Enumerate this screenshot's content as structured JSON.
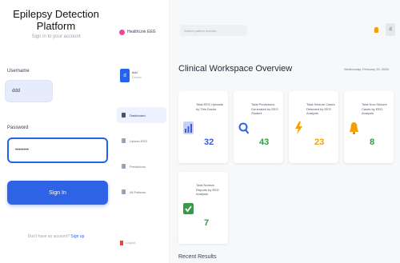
{
  "login": {
    "title": "Epilepsy Detection Platform",
    "subtitle": "Sign in to your account",
    "username_label": "Username",
    "username_value": "ddd",
    "password_label": "Password",
    "password_value": "••••••••",
    "signin_label": "Sign In",
    "signup_text": "Don't have an account?",
    "signup_link": "Sign up"
  },
  "sidebar": {
    "brand": "HealthLink EEG",
    "user_initial": "d",
    "user_name": "ddd",
    "user_role": "Doctor",
    "items": [
      {
        "label": "Dashboard",
        "active": true
      },
      {
        "label": "Upload EEG",
        "active": false
      },
      {
        "label": "Predictions",
        "active": false
      },
      {
        "label": "All Patients",
        "active": false
      }
    ],
    "logout": "Logout"
  },
  "main": {
    "search_placeholder": "Search patient records...",
    "top_avatar": "d",
    "title": "Clinical Workspace Overview",
    "date": "Wednesday, February 25, 2026",
    "cards": [
      {
        "title": "Total EEG Uploads by This Doctor",
        "value": "32",
        "color": "#3b5bdb",
        "icon": "eeg-chart-icon"
      },
      {
        "title": "Total Predictions Generated by EEG Studies",
        "value": "43",
        "color": "#2f9e44",
        "icon": "magnifier-icon"
      },
      {
        "title": "Total Seizure Cases Detected by EEG Analysis",
        "value": "23",
        "color": "#f59f00",
        "icon": "lightning-icon"
      },
      {
        "title": "Total Non-Seizure Cases by EEG Analysis",
        "value": "8",
        "color": "#e67700",
        "icon": "bell-icon"
      },
      {
        "title": "Total Normal Reports by EEG Analysis",
        "value": "7",
        "color": "#2f9e44",
        "icon": "check-icon"
      }
    ],
    "recent_title": "Recent Results"
  }
}
